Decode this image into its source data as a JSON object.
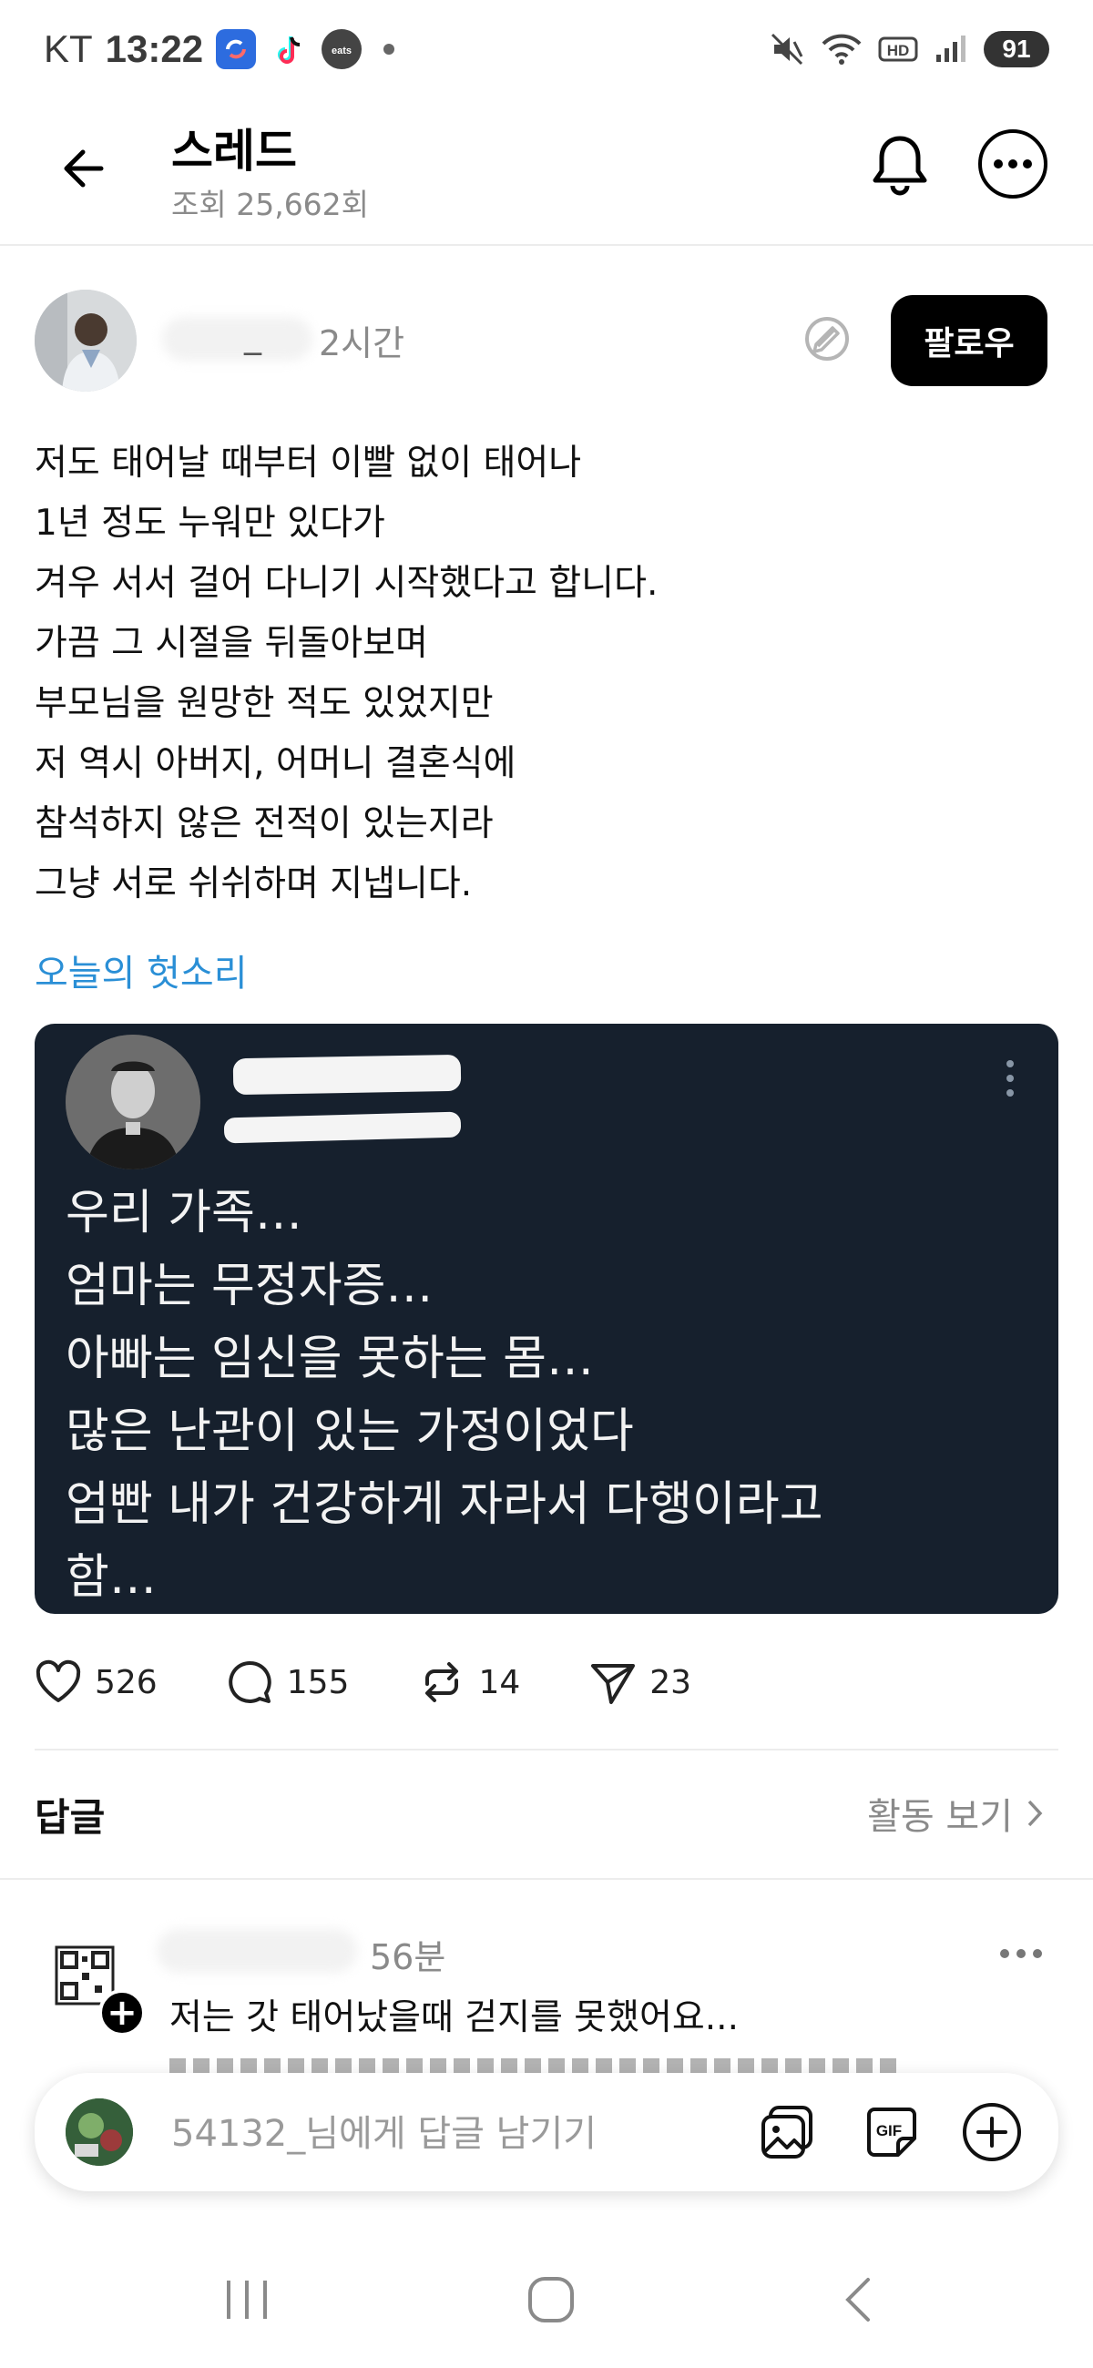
{
  "status_bar": {
    "carrier": "KT",
    "time": "13:22",
    "battery": "91",
    "app_icons": [
      "refresh-app-icon",
      "tiktok-icon",
      "coupang-eats-icon"
    ]
  },
  "header": {
    "title": "스레드",
    "views": "조회 25,662회"
  },
  "post": {
    "username_visible": "_",
    "time": "2시간",
    "follow_label": "팔로우",
    "body_lines": [
      "저도 태어날 때부터 이빨 없이 태어나",
      "1년 정도 누워만 있다가",
      "겨우 서서 걸어 다니기 시작했다고 합니다.",
      "가끔 그 시절을 뒤돌아보며",
      "부모님을 원망한 적도 있었지만",
      "저 역시 아버지, 어머니 결혼식에",
      "참석하지 않은 전적이 있는지라",
      "그냥 서로 쉬쉬하며 지냅니다."
    ],
    "topic": "오늘의 헛소리",
    "image_card": {
      "lines": [
        "우리 가족…",
        "엄마는 무정자증…",
        "아빠는 임신을 못하는 몸…",
        "많은 난관이 있는 가정이었다",
        "엄빤 내가 건강하게 자라서 다행이라고",
        "함…"
      ]
    },
    "stats": {
      "likes": "526",
      "comments": "155",
      "reposts": "14",
      "shares": "23"
    }
  },
  "replies_section": {
    "heading": "답글",
    "activity_link": "활동 보기"
  },
  "reply": {
    "time": "56분",
    "text": "저는 갓 태어났을때 걷지를 못했어요..."
  },
  "composer": {
    "placeholder": "54132_님에게 답글 남기기"
  },
  "colors": {
    "accent_link": "#2a8fd6",
    "card_bg": "#16202d",
    "follow_bg": "#000000"
  }
}
